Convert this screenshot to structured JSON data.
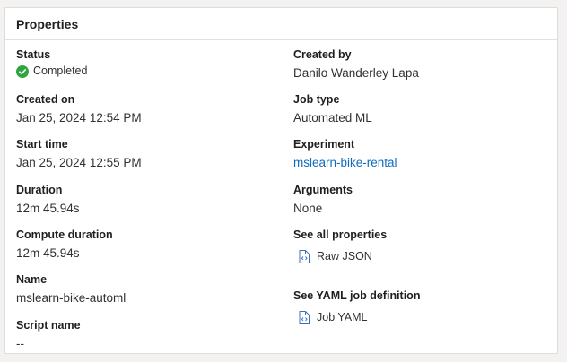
{
  "card": {
    "title": "Properties"
  },
  "left": {
    "status": {
      "label": "Status",
      "value": "Completed"
    },
    "created_on": {
      "label": "Created on",
      "value": "Jan 25, 2024 12:54 PM"
    },
    "start_time": {
      "label": "Start time",
      "value": "Jan 25, 2024 12:55 PM"
    },
    "duration": {
      "label": "Duration",
      "value": "12m 45.94s"
    },
    "compute_duration": {
      "label": "Compute duration",
      "value": "12m 45.94s"
    },
    "name": {
      "label": "Name",
      "value": "mslearn-bike-automl"
    },
    "script_name": {
      "label": "Script name",
      "value": "--"
    }
  },
  "right": {
    "created_by": {
      "label": "Created by",
      "value": "Danilo Wanderley Lapa"
    },
    "job_type": {
      "label": "Job type",
      "value": "Automated ML"
    },
    "experiment": {
      "label": "Experiment",
      "value": "mslearn-bike-rental"
    },
    "arguments": {
      "label": "Arguments",
      "value": "None"
    },
    "all_properties": {
      "label": "See all properties",
      "link": "Raw JSON"
    },
    "yaml": {
      "label": "See YAML job definition",
      "link": "Job YAML"
    }
  },
  "colors": {
    "success": "#2fa43f",
    "link": "#0f6cbd",
    "icon_blue": "#3b73b9"
  },
  "icons": {
    "status": "check-circle-icon",
    "file": "code-file-icon"
  }
}
